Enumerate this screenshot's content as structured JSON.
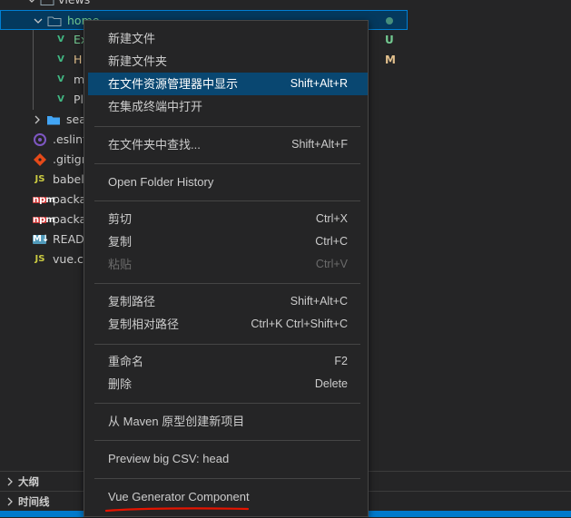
{
  "tree": {
    "rows": [
      {
        "name": "views",
        "type": "folder",
        "expanded": true
      },
      {
        "name": "home",
        "type": "folder",
        "expanded": true,
        "selected": true
      },
      {
        "name": "Ex",
        "type": "vue",
        "badge": "U"
      },
      {
        "name": "H",
        "type": "vue",
        "badge": "M"
      },
      {
        "name": "m",
        "type": "vue"
      },
      {
        "name": "Pl",
        "type": "vue"
      },
      {
        "name": "sea",
        "type": "folder",
        "expanded": false
      },
      {
        "name": ".eslint",
        "type": "eslint"
      },
      {
        "name": ".gitign",
        "type": "git"
      },
      {
        "name": "babel.",
        "type": "js"
      },
      {
        "name": "packa",
        "type": "npm"
      },
      {
        "name": "packa",
        "type": "npm"
      },
      {
        "name": "READI",
        "type": "md"
      },
      {
        "name": "vue.co",
        "type": "js"
      }
    ],
    "icon_labels": {
      "js": "JS",
      "md": "M↓",
      "npm": "npm"
    },
    "badge_colors": {
      "U": "#73c991",
      "M": "#e2c08d"
    }
  },
  "sections": {
    "outline": "大纲",
    "timeline": "时间线"
  },
  "menu": {
    "items": [
      {
        "label": "新建文件",
        "kb": ""
      },
      {
        "label": "新建文件夹",
        "kb": ""
      },
      {
        "label": "在文件资源管理器中显示",
        "kb": "Shift+Alt+R",
        "highlight": true
      },
      {
        "label": "在集成终端中打开",
        "kb": ""
      },
      {
        "label": "在文件夹中查找...",
        "kb": "Shift+Alt+F"
      },
      {
        "label": "Open Folder History",
        "kb": ""
      },
      {
        "label": "剪切",
        "kb": "Ctrl+X"
      },
      {
        "label": "复制",
        "kb": "Ctrl+C"
      },
      {
        "label": "粘贴",
        "kb": "Ctrl+V",
        "disabled": true
      },
      {
        "label": "复制路径",
        "kb": "Shift+Alt+C"
      },
      {
        "label": "复制相对路径",
        "kb": "Ctrl+K Ctrl+Shift+C"
      },
      {
        "label": "重命名",
        "kb": "F2"
      },
      {
        "label": "删除",
        "kb": "Delete"
      },
      {
        "label": "从 Maven 原型创建新项目",
        "kb": ""
      },
      {
        "label": "Preview big CSV: head",
        "kb": ""
      },
      {
        "label": "Vue Generator Component",
        "kb": ""
      }
    ]
  },
  "colors": {
    "accent": "#007acc",
    "highlight": "#094771",
    "annotation": "#e51400"
  }
}
